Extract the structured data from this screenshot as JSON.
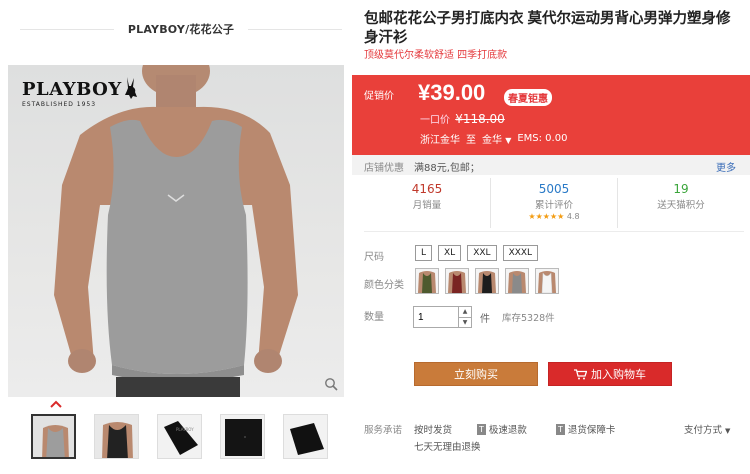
{
  "store": {
    "name": "PLAYBOY/花花公子"
  },
  "gallery": {
    "brand": "PLAYBOY",
    "established": "ESTABLISHED 1953",
    "thumbnails": [
      "thumb-1",
      "thumb-2",
      "thumb-3",
      "thumb-4",
      "thumb-5"
    ]
  },
  "product": {
    "title": "包邮花花公子男打底内衣 莫代尔运动男背心男弹力塑身修身汗衫",
    "subtitle": "顶级莫代尔柔软舒适 四季打底款"
  },
  "price": {
    "label": "促销价",
    "value": "¥39.00",
    "promo_tag": "春夏钜惠",
    "orig_label": "一口价",
    "orig_value": "¥118.00",
    "ship_from": "浙江金华",
    "ship_to_label": "至",
    "ship_to": "金华",
    "ems": "EMS: 0.00"
  },
  "coupon": {
    "label": "店铺优惠",
    "text": "满88元,包邮；",
    "more": "更多"
  },
  "stats": {
    "sales": {
      "num": "4165",
      "label": "月销量"
    },
    "reviews": {
      "num": "5005",
      "label": "累计评价",
      "stars": "★★★★★",
      "rating": "4.8"
    },
    "points": {
      "num": "19",
      "label": "送天猫积分"
    }
  },
  "options": {
    "size_label": "尺码",
    "sizes": [
      "L",
      "XL",
      "XXL",
      "XXXL"
    ],
    "color_label": "颜色分类",
    "qty_label": "数量",
    "qty_value": "1",
    "qty_unit": "件",
    "stock": "库存5328件"
  },
  "actions": {
    "buy": "立刻购买",
    "cart": "加入购物车"
  },
  "service": {
    "label": "服务承诺",
    "s1": "按时发货",
    "s2": "极速退款",
    "s3": "退货保障卡",
    "pay": "支付方式",
    "s4": "七天无理由退换",
    "badge": "T"
  },
  "colors": {
    "accent": "#e9403a",
    "buy": "#c97b3a",
    "cart": "#d92a2a"
  }
}
